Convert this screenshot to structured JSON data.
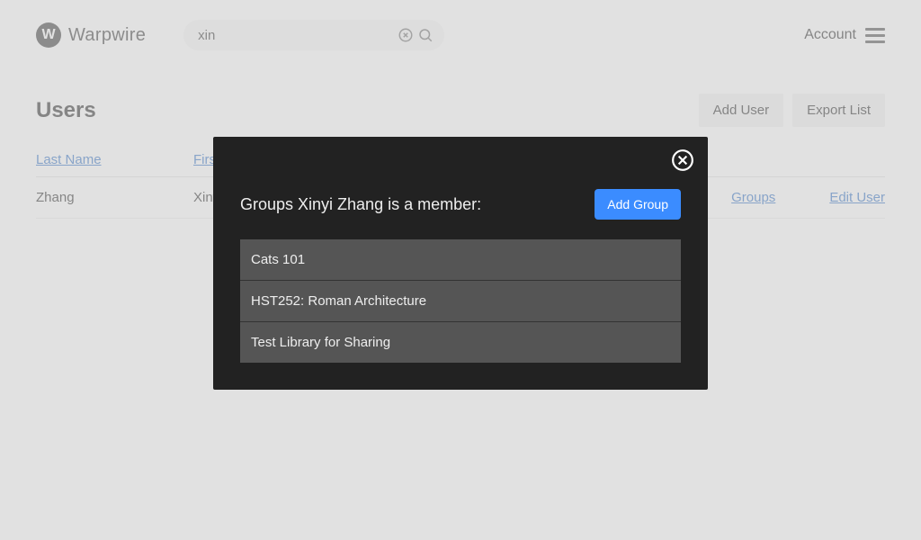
{
  "brand": {
    "name": "Warpwire",
    "mark": "W"
  },
  "search": {
    "value": "xin"
  },
  "account": {
    "label": "Account"
  },
  "page": {
    "title": "Users"
  },
  "actions": {
    "add_user": "Add User",
    "export": "Export List"
  },
  "columns": {
    "last": "Last Name",
    "first": "First Name"
  },
  "rows": [
    {
      "last": "Zhang",
      "first": "Xinyi",
      "groups_link": "Groups",
      "edit_link": "Edit User"
    }
  ],
  "modal": {
    "title": "Groups Xinyi Zhang is a member:",
    "add_group": "Add Group",
    "groups": [
      "Cats 101",
      "HST252: Roman Architecture",
      "Test Library for Sharing"
    ]
  }
}
